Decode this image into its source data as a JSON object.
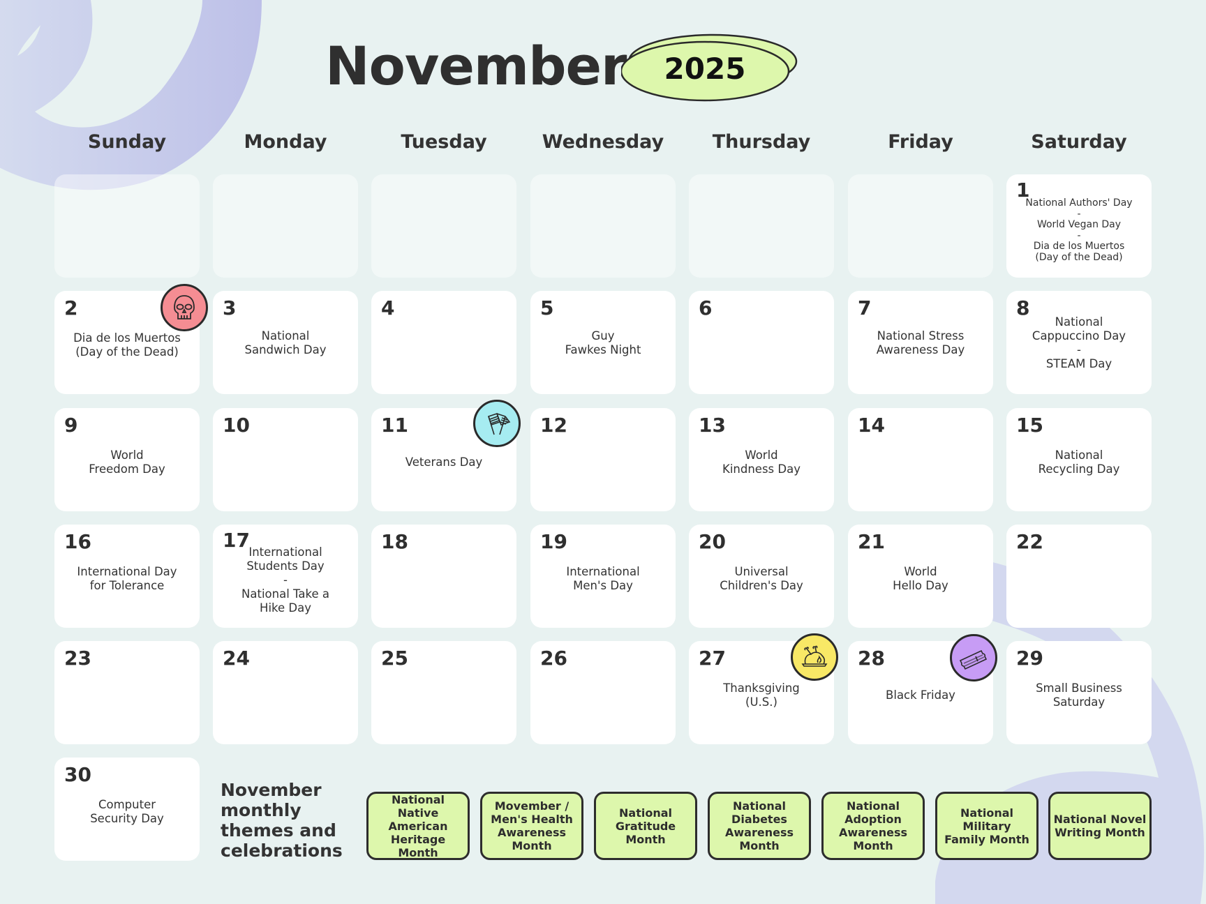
{
  "header": {
    "month": "November",
    "year": "2025"
  },
  "colors": {
    "background": "#e8f2f1",
    "year_pill": "#ddf7ac",
    "theme_box": "#ddf7ac",
    "decor_swirl": "#bcbfe6",
    "skull_badge": "#f58d93",
    "flag_badge": "#a6ecf1",
    "turkey_badge": "#f8e866",
    "ticket_badge": "#c79cf5"
  },
  "weekdays": [
    "Sunday",
    "Monday",
    "Tuesday",
    "Wednesday",
    "Thursday",
    "Friday",
    "Saturday"
  ],
  "days": [
    {
      "day": "1",
      "events": "National Authors' Day\n-\nWorld Vegan Day\n-\nDia de los Muertos\n(Day of the Dead)"
    },
    {
      "day": "2",
      "events": "Dia de los Muertos\n(Day of the Dead)",
      "icon": "skull-icon"
    },
    {
      "day": "3",
      "events": "National\nSandwich Day"
    },
    {
      "day": "4",
      "events": ""
    },
    {
      "day": "5",
      "events": "Guy\nFawkes Night"
    },
    {
      "day": "6",
      "events": ""
    },
    {
      "day": "7",
      "events": "National Stress\nAwareness Day"
    },
    {
      "day": "8",
      "events": "National\nCappuccino Day\n-\nSTEAM Day"
    },
    {
      "day": "9",
      "events": "World\nFreedom Day"
    },
    {
      "day": "10",
      "events": ""
    },
    {
      "day": "11",
      "events": "Veterans Day",
      "icon": "crossed-flags-icon"
    },
    {
      "day": "12",
      "events": ""
    },
    {
      "day": "13",
      "events": "World\nKindness Day"
    },
    {
      "day": "14",
      "events": ""
    },
    {
      "day": "15",
      "events": "National\nRecycling Day"
    },
    {
      "day": "16",
      "events": "International Day\nfor Tolerance"
    },
    {
      "day": "17",
      "events": "International\nStudents Day\n-\nNational Take a\nHike Day"
    },
    {
      "day": "18",
      "events": ""
    },
    {
      "day": "19",
      "events": "International\nMen's Day"
    },
    {
      "day": "20",
      "events": "Universal\nChildren's Day"
    },
    {
      "day": "21",
      "events": "World\nHello Day"
    },
    {
      "day": "22",
      "events": ""
    },
    {
      "day": "23",
      "events": ""
    },
    {
      "day": "24",
      "events": ""
    },
    {
      "day": "25",
      "events": ""
    },
    {
      "day": "26",
      "events": ""
    },
    {
      "day": "27",
      "events": "Thanksgiving\n(U.S.)",
      "icon": "roast-turkey-icon"
    },
    {
      "day": "28",
      "events": "Black Friday",
      "icon": "ticket-icon"
    },
    {
      "day": "29",
      "events": "Small Business\nSaturday"
    },
    {
      "day": "30",
      "events": "Computer\nSecurity Day"
    }
  ],
  "monthly_themes": {
    "label": "November\nmonthly\nthemes and\ncelebrations",
    "items": [
      "National Native\nAmerican\nHeritage Month",
      "Movember /\nMen's Health\nAwareness\nMonth",
      "National\nGratitude\nMonth",
      "National\nDiabetes\nAwareness\nMonth",
      "National\nAdoption\nAwareness\nMonth",
      "National\nMilitary\nFamily Month",
      "National Novel\nWriting Month"
    ]
  }
}
